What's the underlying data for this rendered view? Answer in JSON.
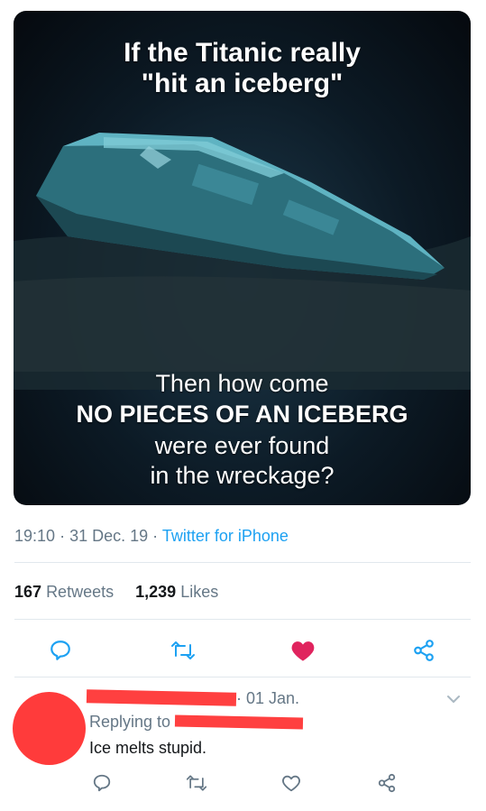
{
  "meme": {
    "line1": "If the Titanic really",
    "line2": "\"hit an iceberg\"",
    "line3": "Then how come",
    "line4": "NO PIECES OF AN ICEBERG",
    "line5": "were ever found",
    "line6": "in the wreckage?"
  },
  "tweet": {
    "time": "19:10",
    "date": "31 Dec. 19",
    "source": "Twitter for iPhone",
    "retweets_count": "167",
    "retweets_label": "Retweets",
    "likes_count": "1,239",
    "likes_label": "Likes",
    "liked": true
  },
  "reply": {
    "date": "01 Jan.",
    "replying_prefix": "Replying to",
    "text": "Ice melts stupid."
  },
  "colors": {
    "accent": "#1da1f2",
    "like": "#e0245e",
    "redaction": "#ff4040",
    "muted": "#657786"
  }
}
